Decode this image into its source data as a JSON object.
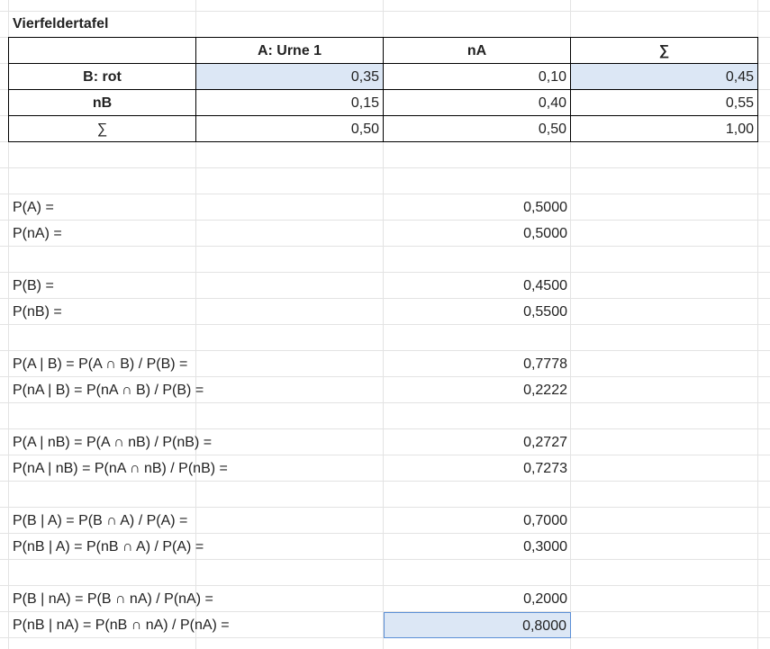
{
  "sheet": {
    "title": "Vierfeldertafel",
    "table": {
      "headers": [
        "",
        "A: Urne 1",
        "nA",
        "∑"
      ],
      "rows": [
        {
          "label": "B: rot",
          "values": [
            "0,35",
            "0,10",
            "0,45"
          ]
        },
        {
          "label": "nB",
          "values": [
            "0,15",
            "0,40",
            "0,55"
          ]
        },
        {
          "label": "∑",
          "values": [
            "0,50",
            "0,50",
            "1,00"
          ]
        }
      ]
    },
    "probabilities": [
      {
        "label": "P(A) =",
        "value": "0,5000"
      },
      {
        "label": "P(nA) =",
        "value": "0,5000"
      },
      {
        "label": "P(B) =",
        "value": "0,4500"
      },
      {
        "label": "P(nB) =",
        "value": "0,5500"
      },
      {
        "label": "P(A | B) = P(A ∩ B) / P(B) =",
        "value": "0,7778"
      },
      {
        "label": "P(nA | B) = P(nA ∩ B) / P(B) =",
        "value": "0,2222"
      },
      {
        "label": "P(A | nB) = P(A ∩ nB) / P(nB) =",
        "value": "0,2727"
      },
      {
        "label": "P(nA | nB) = P(nA ∩ nB) / P(nB) =",
        "value": "0,7273"
      },
      {
        "label": "P(B | A) = P(B ∩ A) / P(A) =",
        "value": "0,7000"
      },
      {
        "label": "P(nB | A) = P(nB ∩ A) / P(A) =",
        "value": "0,3000"
      },
      {
        "label": "P(B | nA) = P(B ∩ nA) / P(nA) =",
        "value": "0,2000"
      },
      {
        "label": "P(nB | nA) = P(nB ∩ nA) / P(nA) =",
        "value": "0,8000"
      }
    ]
  }
}
